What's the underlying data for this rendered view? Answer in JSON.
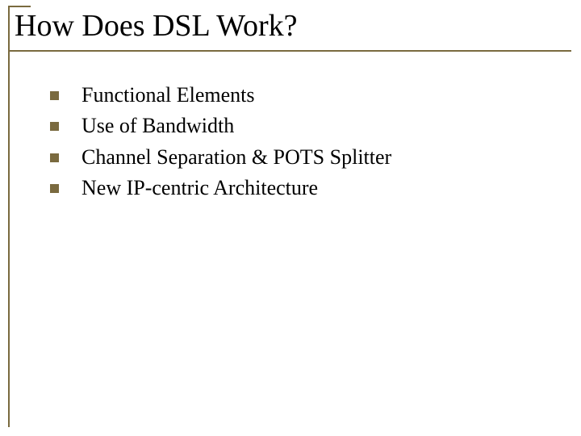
{
  "title": "How Does DSL Work?",
  "items": [
    "Functional Elements",
    "Use of Bandwidth",
    "Channel Separation & POTS Splitter",
    "New IP-centric Architecture"
  ]
}
